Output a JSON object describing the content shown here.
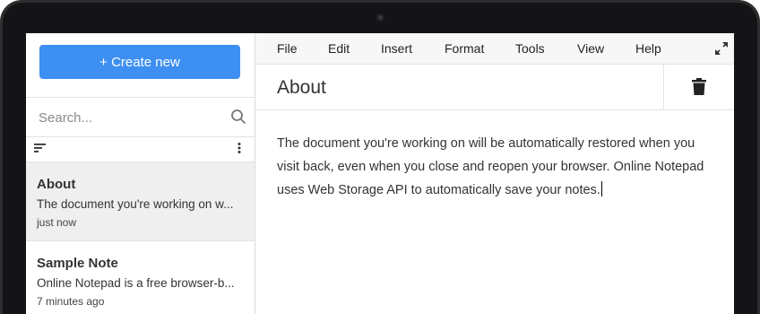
{
  "sidebar": {
    "create_label": "+ Create new",
    "search_placeholder": "Search...",
    "notes": [
      {
        "title": "About",
        "preview": "The document you're working on w...",
        "time": "just now"
      },
      {
        "title": "Sample Note",
        "preview": "Online Notepad is a free browser-b...",
        "time": "7 minutes ago"
      }
    ]
  },
  "menu": {
    "items": [
      "File",
      "Edit",
      "Insert",
      "Format",
      "Tools",
      "View",
      "Help"
    ]
  },
  "document": {
    "title": "About",
    "body": "The document you're working on will be automatically restored when you visit back, even when you close and reopen your browser. Online Notepad uses Web Storage API to automatically save your notes."
  },
  "colors": {
    "accent": "#3d8ff1",
    "active_item": "#efefef",
    "frame": "#2e2e30"
  },
  "icons": {
    "search": "search-icon",
    "sort": "sort-icon",
    "more": "more-vertical-icon",
    "expand": "expand-icon",
    "delete": "trash-icon",
    "camera": "camera-icon"
  }
}
